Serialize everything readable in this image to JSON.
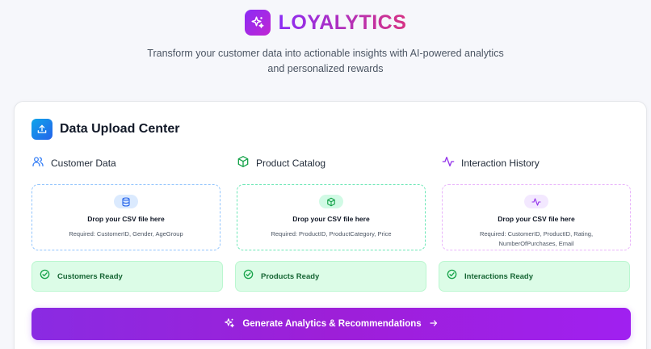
{
  "brand": {
    "name": "LOYALYTICS"
  },
  "tagline": {
    "line1": "Transform your customer data into actionable insights with AI-powered analytics",
    "line2": "and personalized rewards"
  },
  "upload_center": {
    "title": "Data Upload Center",
    "columns": [
      {
        "label": "Customer Data",
        "icon": "users-icon",
        "drop_text": "Drop your CSV file here",
        "required": "Required: CustomerID, Gender, AgeGroup",
        "ready": "Customers Ready",
        "accent": "#60a5fa"
      },
      {
        "label": "Product Catalog",
        "icon": "box-icon",
        "drop_text": "Drop your CSV file here",
        "required": "Required: ProductID, ProductCategory, Price",
        "ready": "Products Ready",
        "accent": "#4ade80"
      },
      {
        "label": "Interaction History",
        "icon": "activity-icon",
        "drop_text": "Drop your CSV file here",
        "required_line1": "Required: CustomerID, ProductID, Rating,",
        "required_line2": "NumberOfPurchases, Email",
        "ready": "Interactions Ready",
        "accent": "#d8b4fe"
      }
    ],
    "generate_button": "Generate Analytics & Recommendations"
  },
  "colors": {
    "brand_gradient_start": "#8b2cf5",
    "brand_gradient_end": "#d63384",
    "ready_bg": "#dcfce7",
    "ready_text": "#166534"
  }
}
